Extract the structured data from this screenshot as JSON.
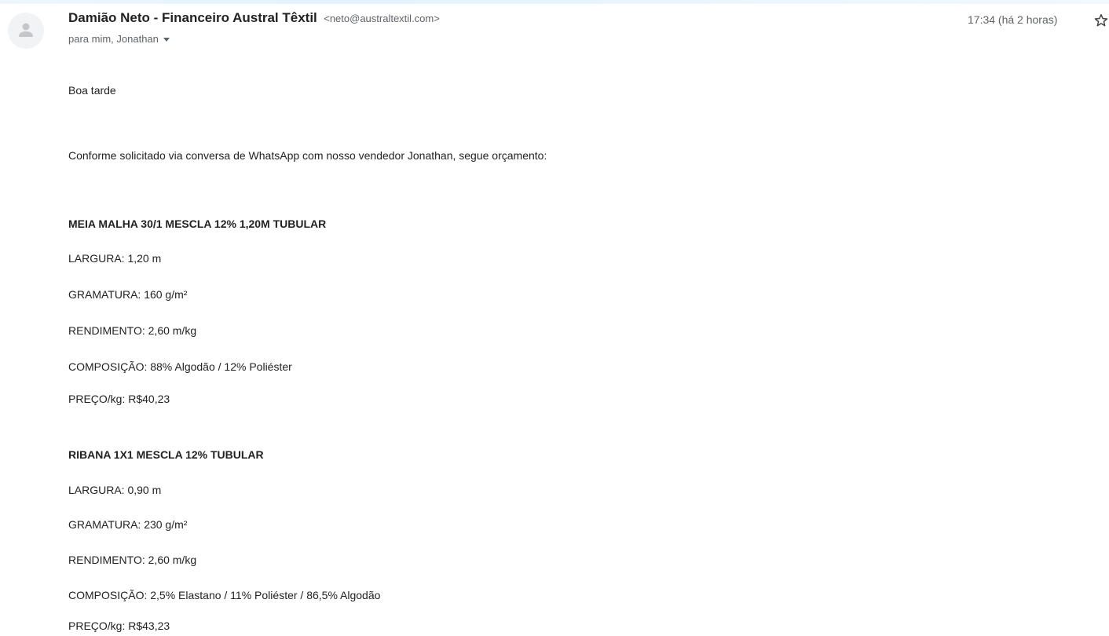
{
  "email": {
    "sender_name": "Damião Neto - Financeiro Austral Têxtil",
    "sender_email": "<neto@australtextil.com>",
    "recipients": "para mim, Jonathan",
    "timestamp": "17:34 (há 2 horas)",
    "icons": {
      "avatar": "person-avatar-icon",
      "star": "star-outline-icon",
      "recipients_toggle": "caret-down-icon"
    }
  },
  "body": {
    "greeting": "Boa tarde",
    "intro": "Conforme solicitado via conversa de WhatsApp com nosso vendedor Jonathan, segue orçamento:",
    "products": [
      {
        "name": "MEIA MALHA 30/1 MESCLA 12% 1,20M TUBULAR",
        "largura": "LARGURA: 1,20 m",
        "gramatura": "GRAMATURA: 160 g/m²",
        "rendimento": "RENDIMENTO: 2,60 m/kg",
        "composicao": "COMPOSIÇÃO: 88% Algodão / 12% Poliéster",
        "preco": "PREÇO/kg: R$40,23"
      },
      {
        "name": "RIBANA 1X1 MESCLA 12% TUBULAR",
        "largura": "LARGURA: 0,90 m",
        "gramatura": "GRAMATURA: 230 g/m²",
        "rendimento": "RENDIMENTO: 2,60 m/kg",
        "composicao": "COMPOSIÇÃO: 2,5% Elastano / 11% Poliéster / 86,5% Algodão",
        "preco": "PREÇO/kg: R$43,23"
      }
    ]
  }
}
